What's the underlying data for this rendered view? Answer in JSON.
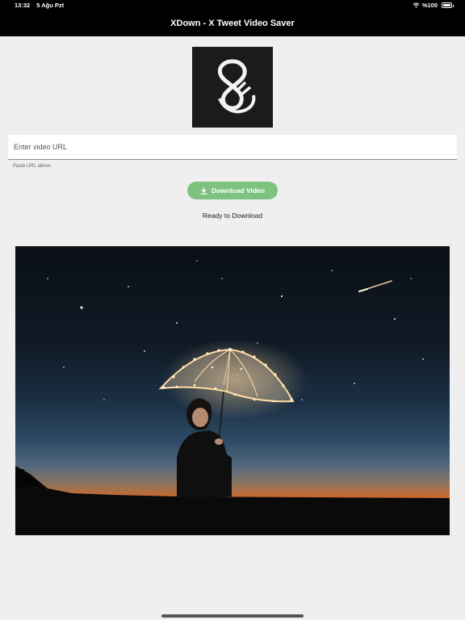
{
  "status_bar": {
    "time": "13:32",
    "date": "5 Ağu Pzt",
    "battery": "%100"
  },
  "nav": {
    "title": "XDown - X Tweet Video Saver"
  },
  "url_input": {
    "placeholder": "Enter video URL",
    "value": ""
  },
  "helper_text": "Paste URL above",
  "download_button": {
    "label": "Download Video",
    "color": "#7ec27f"
  },
  "status_message": "Ready to Download",
  "icons": [
    "wifi-icon",
    "battery-icon",
    "app-logo-icon",
    "download-icon"
  ],
  "colors": {
    "bar_background": "#000000",
    "page_background": "#efefef"
  }
}
